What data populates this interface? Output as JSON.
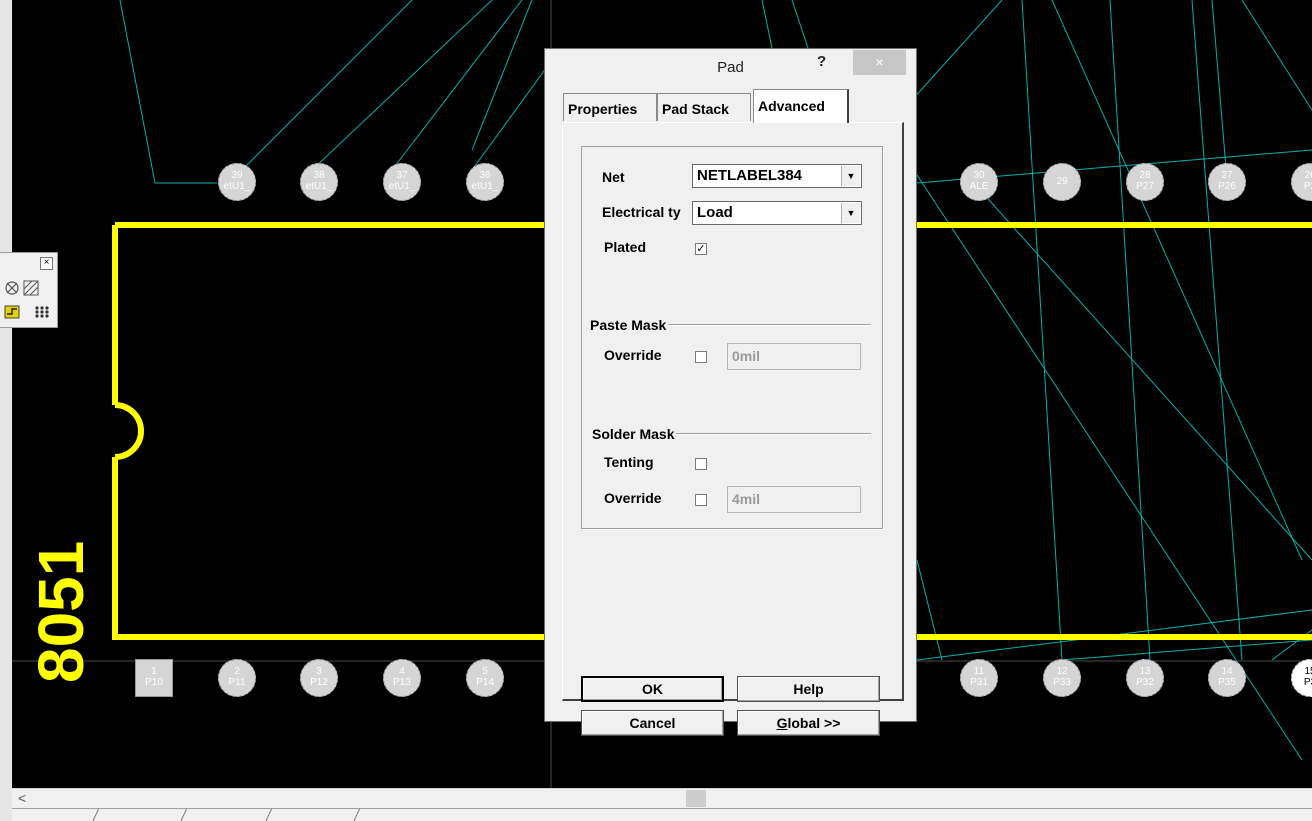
{
  "pcb": {
    "top_pads": [
      {
        "num": "39",
        "net": "etU1_"
      },
      {
        "num": "38",
        "net": "etU1_"
      },
      {
        "num": "37",
        "net": "etU1_"
      },
      {
        "num": "36",
        "net": "etU1_"
      },
      {
        "num": "30",
        "net": "ALE"
      },
      {
        "num": "29",
        "net": ""
      },
      {
        "num": "28",
        "net": "P27"
      },
      {
        "num": "27",
        "net": "P26"
      },
      {
        "num": "26",
        "net": "P2"
      }
    ],
    "bottom_pads": [
      {
        "num": "1",
        "net": "P10"
      },
      {
        "num": "2",
        "net": "P11"
      },
      {
        "num": "3",
        "net": "P12"
      },
      {
        "num": "4",
        "net": "P13"
      },
      {
        "num": "5",
        "net": "P14"
      },
      {
        "num": "11",
        "net": "P31"
      },
      {
        "num": "12",
        "net": "P33"
      },
      {
        "num": "13",
        "net": "P32"
      },
      {
        "num": "14",
        "net": "P35"
      },
      {
        "num": "15",
        "net": "P3"
      }
    ],
    "component_label": "8051",
    "colors": {
      "board": "#000000",
      "silkscreen": "#ffff00",
      "ratsnest": "#00b0b0",
      "pad": "#d5d5d5"
    }
  },
  "scrollbar": {
    "left_arrow": "<"
  },
  "dialog": {
    "title": "Pad",
    "help_glyph": "?",
    "close_glyph": "×",
    "tabs": [
      {
        "label": "Properties",
        "active": false
      },
      {
        "label": "Pad Stack",
        "active": false
      },
      {
        "label": "Advanced",
        "active": true
      }
    ],
    "net_label": "Net",
    "net_value": "NETLABEL384",
    "electrical_type_label": "Electrical ty",
    "electrical_type_value": "Load",
    "plated_label": "Plated",
    "plated_checked": true,
    "paste_mask": {
      "title": "Paste Mask",
      "override_label": "Override",
      "override_checked": false,
      "override_value": "0mil"
    },
    "solder_mask": {
      "title": "Solder Mask",
      "tenting_label": "Tenting",
      "tenting_checked": false,
      "override_label": "Override",
      "override_checked": false,
      "override_value": "4mil"
    },
    "buttons": {
      "ok": "OK",
      "help": "Help",
      "cancel": "Cancel",
      "global_mnemonic": "G",
      "global_rest": "lobal >>"
    }
  },
  "toolbox": {
    "close_glyph": "×"
  }
}
